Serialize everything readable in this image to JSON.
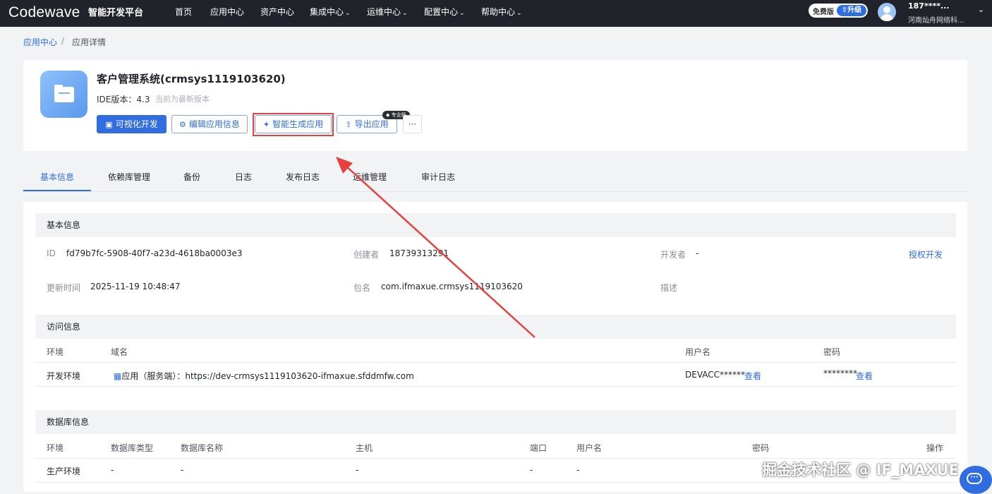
{
  "topbar": {
    "logo": "Codewave",
    "brand": "智能开发平台",
    "nav": [
      {
        "label": "首页",
        "caret": ""
      },
      {
        "label": "应用中心",
        "caret": ""
      },
      {
        "label": "资产中心",
        "caret": ""
      },
      {
        "label": "集成中心",
        "caret": "⌄"
      },
      {
        "label": "运维中心",
        "caret": "⌄"
      },
      {
        "label": "配置中心",
        "caret": "⌄"
      },
      {
        "label": "帮助中心",
        "caret": "⌄"
      }
    ],
    "plan": "免费版",
    "upgrade": "⇧升级",
    "user_name": "187****...",
    "user_org": "河南灿舟网络科..."
  },
  "breadcrumb": {
    "parent": "应用中心",
    "separator": "/",
    "current": "应用详情"
  },
  "app": {
    "title": "客户管理系统(crmsys1119103620)",
    "ide_version_label": "IDE版本：",
    "ide_version": "4.3",
    "version_note": "当前为最新版本",
    "buttons": {
      "visual_dev": "可视化开发",
      "edit_info": "编辑应用信息",
      "ai_generate": "智能生成应用",
      "export": "导出应用",
      "more": "···"
    },
    "pro_badge": "专业版"
  },
  "tabs": [
    "基本信息",
    "依赖库管理",
    "备份",
    "日志",
    "发布日志",
    "运维管理",
    "审计日志"
  ],
  "basic_info": {
    "heading": "基本信息",
    "id_label": "ID",
    "id": "fd79b7fc-5908-40f7-a23d-4618ba0003e3",
    "creator_label": "创建者",
    "creator": "18739313291",
    "developer_label": "开发者",
    "developer": "-",
    "authorize_link": "授权开发",
    "updated_label": "更新时间",
    "updated": "2025-11-19 10:48:47",
    "package_label": "包名",
    "package": "com.ifmaxue.crmsys1119103620",
    "desc_label": "描述"
  },
  "access_info": {
    "heading": "访问信息",
    "headers": {
      "env": "环境",
      "domain": "域名",
      "user": "用户名",
      "password": "密码"
    },
    "row": {
      "env": "开发环境",
      "domain": "应用（服务端）：https://dev-crmsys1119103620-ifmaxue.sfddmfw.com",
      "user": "DEVACC******",
      "user_view": "查看",
      "password": "********",
      "password_view": "查看"
    }
  },
  "db_info": {
    "heading": "数据库信息",
    "headers": {
      "env": "环境",
      "type": "数据库类型",
      "name": "数据库名称",
      "host": "主机",
      "port": "端口",
      "user": "用户名",
      "password": "密码",
      "action": "操作"
    },
    "rows": [
      {
        "env": "生产环境",
        "type": "-",
        "name": "-",
        "host": "-",
        "port": "-",
        "user": "-"
      }
    ]
  },
  "watermark": "掘金技术社区 @ IF_MAXUE",
  "colors": {
    "accent": "#2f6de0",
    "highlight": "#e8403f",
    "topbar": "#202329"
  }
}
